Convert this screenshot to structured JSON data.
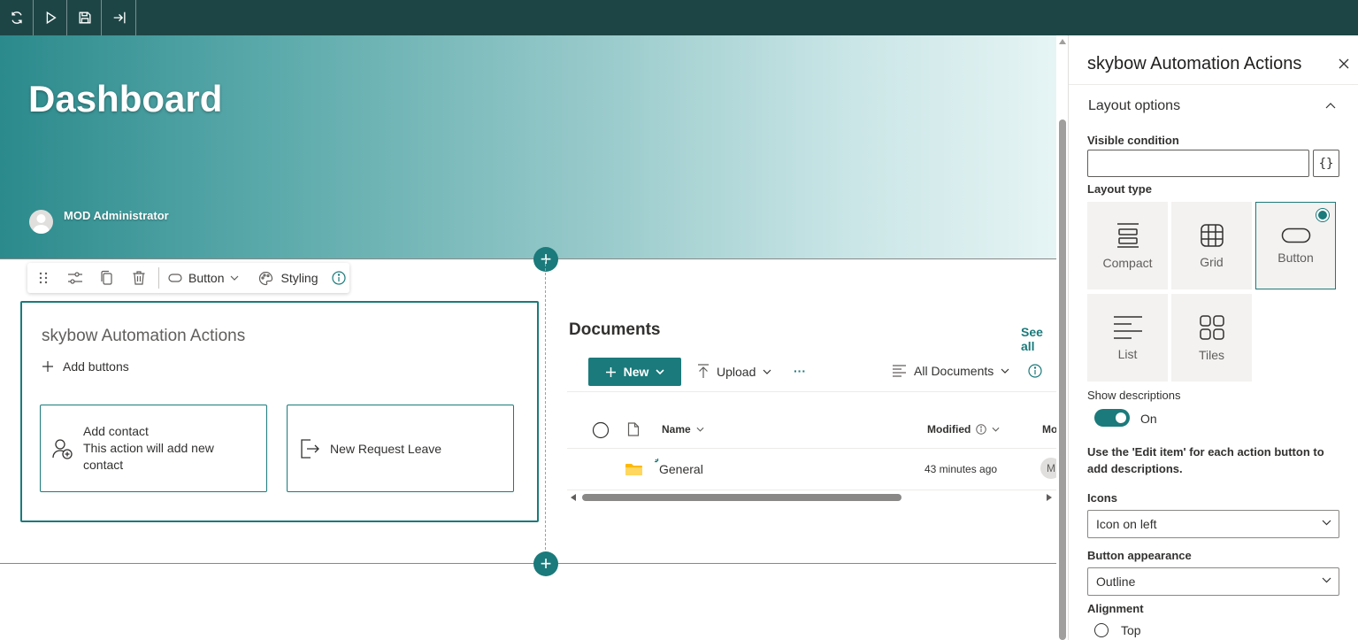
{
  "topbar": {
    "buttons": [
      {
        "icon": "refresh-icon"
      },
      {
        "icon": "play-icon"
      },
      {
        "icon": "save-icon"
      },
      {
        "icon": "exit-icon"
      }
    ]
  },
  "hero": {
    "title": "Dashboard",
    "author": "MOD Administrator"
  },
  "webpart_toolbar": {
    "layout_label": "Button",
    "styling_label": "Styling"
  },
  "webpart": {
    "title": "skybow Automation Actions",
    "add_buttons_label": "Add buttons",
    "actions": [
      {
        "title": "Add contact",
        "description": "This action will add new contact",
        "icon": "add-contact-icon"
      },
      {
        "title": "New Request Leave",
        "description": "",
        "icon": "sign-out-icon"
      }
    ]
  },
  "documents": {
    "title": "Documents",
    "see_all": "See all",
    "new_label": "New",
    "upload_label": "Upload",
    "more_label": "···",
    "view_label": "All Documents",
    "columns": {
      "name": "Name",
      "modified": "Modified",
      "modified_by": "Mo"
    },
    "rows": [
      {
        "name": "General",
        "modified": "43 minutes ago",
        "modified_by_initial": "M"
      }
    ]
  },
  "panel": {
    "title": "skybow Automation Actions",
    "section_title": "Layout options",
    "visible_condition_label": "Visible condition",
    "visible_condition_value": "",
    "expression_button": "{}",
    "layout_type_label": "Layout type",
    "layout_types": [
      {
        "label": "Compact",
        "icon": "compact-icon",
        "selected": false
      },
      {
        "label": "Grid",
        "icon": "grid-icon",
        "selected": false
      },
      {
        "label": "Button",
        "icon": "button-shape-icon",
        "selected": true
      },
      {
        "label": "List",
        "icon": "list-icon",
        "selected": false
      },
      {
        "label": "Tiles",
        "icon": "tiles-icon",
        "selected": false
      }
    ],
    "show_descriptions_label": "Show descriptions",
    "show_descriptions_state": "On",
    "description_note": "Use the 'Edit item' for each action button to add descriptions.",
    "icons_label": "Icons",
    "icons_value": "Icon on left",
    "button_appearance_label": "Button appearance",
    "button_appearance_value": "Outline",
    "alignment_label": "Alignment",
    "alignment_option": "Top"
  },
  "colors": {
    "accent": "#1b7a7b",
    "topbar": "#1e4545"
  }
}
